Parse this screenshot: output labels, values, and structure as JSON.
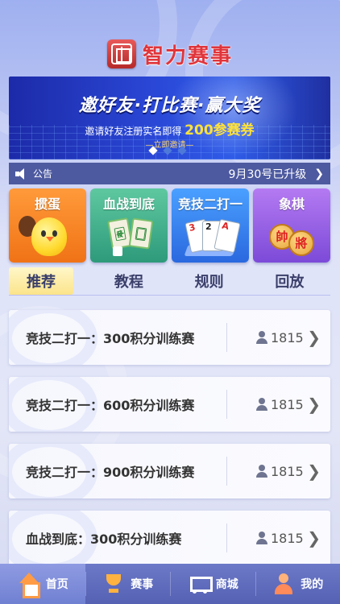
{
  "app": {
    "title": "智力赛事"
  },
  "banner": {
    "headline": "邀好友·打比赛·赢大奖",
    "sub_prefix": "邀请好友注册实名即得",
    "sub_highlight": "200参赛券",
    "invite_label": "—立即邀请—",
    "carousel": {
      "count": 3,
      "active_index": 0
    }
  },
  "notice": {
    "label": "公告",
    "message": "9月30号已升级"
  },
  "games": [
    {
      "name": "掼蛋"
    },
    {
      "name": "血战到底"
    },
    {
      "name": "竞技二打一"
    },
    {
      "name": "象棋"
    }
  ],
  "tabs": [
    {
      "label": "推荐",
      "active": true
    },
    {
      "label": "教程",
      "active": false
    },
    {
      "label": "规则",
      "active": false
    },
    {
      "label": "回放",
      "active": false
    }
  ],
  "matches": [
    {
      "title": "竞技二打一：300积分训练赛",
      "players": "1815"
    },
    {
      "title": "竞技二打一：600积分训练赛",
      "players": "1815"
    },
    {
      "title": "竞技二打一：900积分训练赛",
      "players": "1815"
    },
    {
      "title": "血战到底：300积分训练赛",
      "players": "1815"
    }
  ],
  "nav": [
    {
      "label": "首页",
      "icon": "home-icon",
      "active": true
    },
    {
      "label": "赛事",
      "icon": "trophy-icon",
      "active": false
    },
    {
      "label": "商城",
      "icon": "cart-icon",
      "active": false
    },
    {
      "label": "我的",
      "icon": "user-icon",
      "active": false
    }
  ],
  "colors": {
    "title_red": "#e0353b",
    "banner_blue": "#2a47d6",
    "tab_active": "#fbe48a",
    "nav_bg": "#5561b3"
  }
}
